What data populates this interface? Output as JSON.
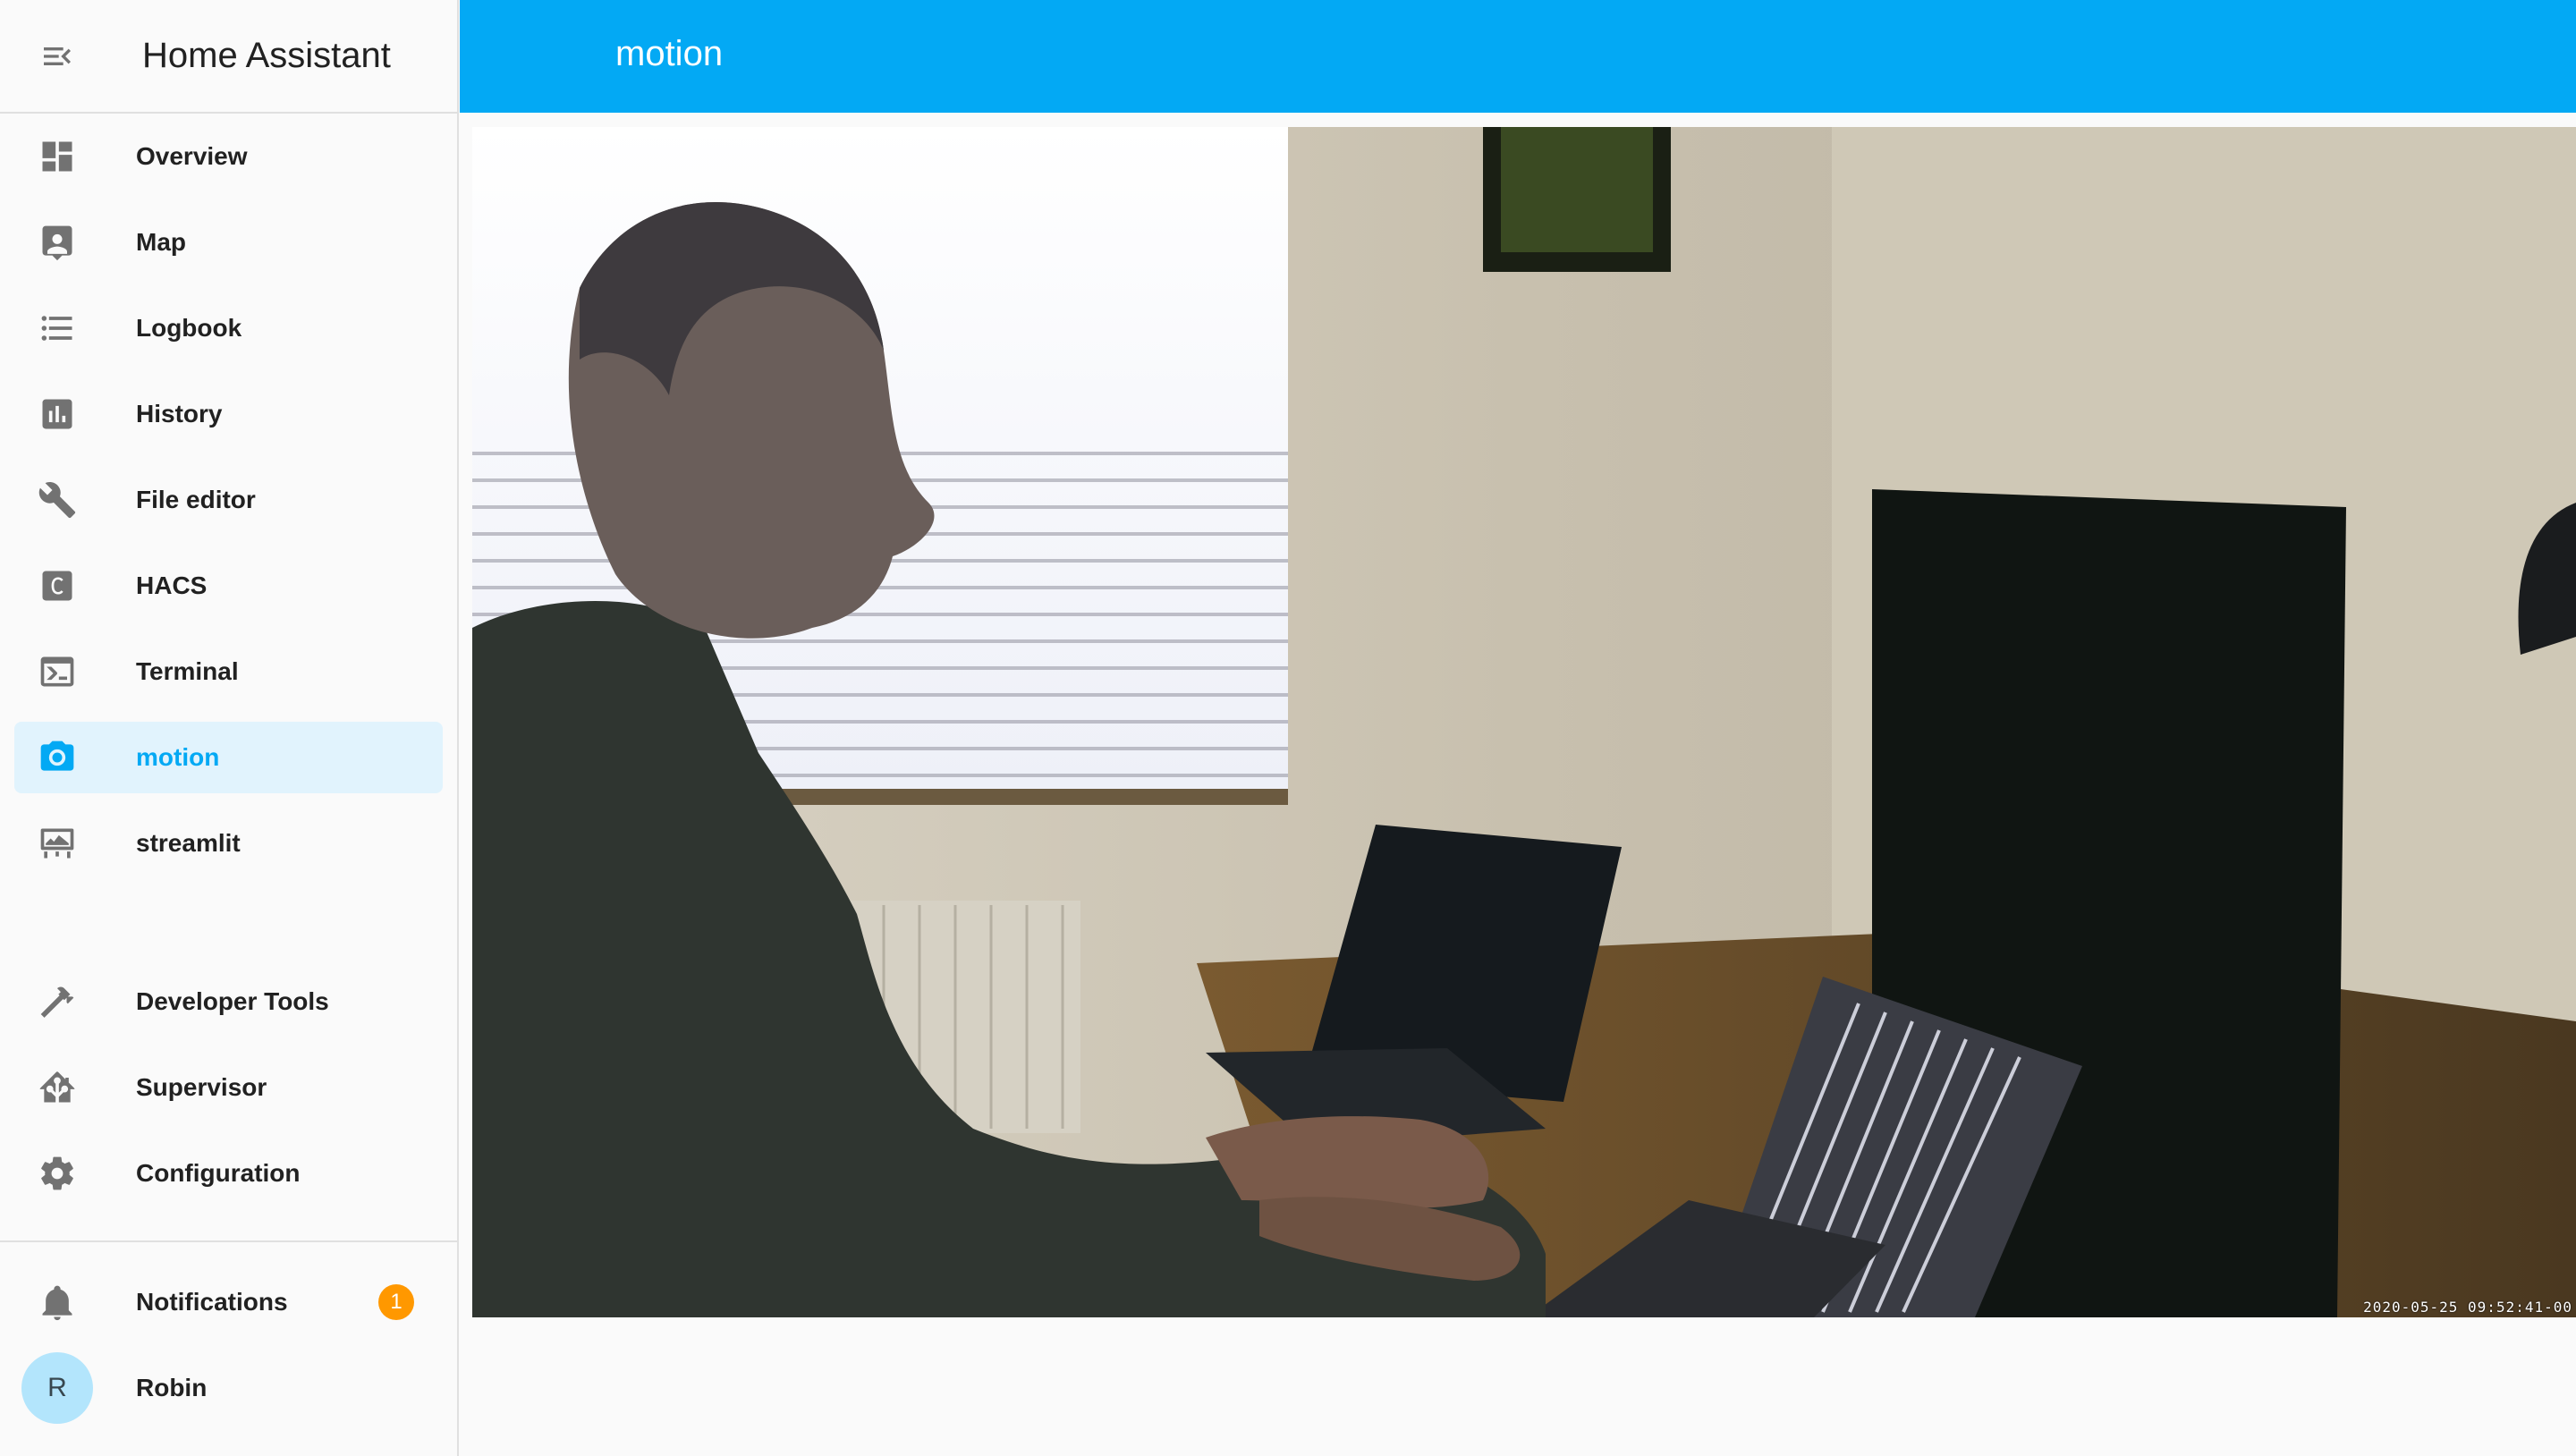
{
  "app": {
    "title": "Home Assistant"
  },
  "header": {
    "title": "motion"
  },
  "sidebar": {
    "items": [
      {
        "label": "Overview",
        "icon": "view-dashboard-icon"
      },
      {
        "label": "Map",
        "icon": "account-box-icon"
      },
      {
        "label": "Logbook",
        "icon": "format-list-bulleted-icon"
      },
      {
        "label": "History",
        "icon": "chart-box-icon"
      },
      {
        "label": "File editor",
        "icon": "wrench-icon"
      },
      {
        "label": "HACS",
        "icon": "hacs-icon"
      },
      {
        "label": "Terminal",
        "icon": "console-icon"
      },
      {
        "label": "motion",
        "icon": "camera-icon",
        "selected": true
      },
      {
        "label": "streamlit",
        "icon": "monitor-dashboard-icon"
      }
    ],
    "bottom_items": [
      {
        "label": "Developer Tools",
        "icon": "hammer-icon"
      },
      {
        "label": "Supervisor",
        "icon": "home-assistant-icon"
      },
      {
        "label": "Configuration",
        "icon": "cog-icon"
      }
    ],
    "notifications": {
      "label": "Notifications",
      "count": "1"
    },
    "user": {
      "name": "Robin",
      "initial": "R"
    }
  },
  "camera": {
    "timestamp": "2020-05-25 09:52:41-00"
  },
  "colors": {
    "accent": "#03a9f4",
    "selected_bg": "#e1f3fd",
    "badge": "#ff9800",
    "icon": "#727272"
  }
}
